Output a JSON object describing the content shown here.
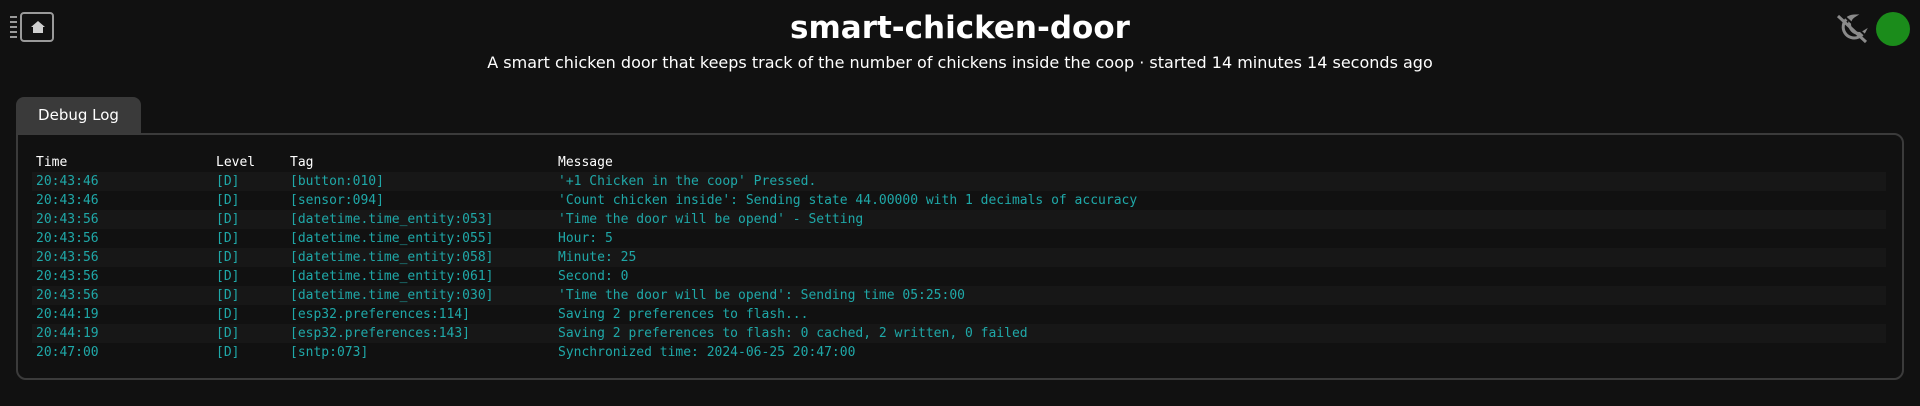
{
  "header": {
    "title": "smart-chicken-door",
    "subtitle": "A smart chicken door that keeps track of the number of chickens inside the coop · started 14 minutes 14 seconds ago",
    "logo_icon": "chip-home-icon",
    "theme_icon": "dark-mode-toggle-icon",
    "status_color": "#1b8c1b"
  },
  "tabs": [
    {
      "label": "Debug Log"
    }
  ],
  "log": {
    "columns": {
      "time": "Time",
      "level": "Level",
      "tag": "Tag",
      "message": "Message"
    },
    "rows": [
      {
        "time": "20:43:46",
        "level": "[D]",
        "tag": "[button:010]",
        "message": "'+1 Chicken in the coop' Pressed."
      },
      {
        "time": "20:43:46",
        "level": "[D]",
        "tag": "[sensor:094]",
        "message": "'Count chicken inside': Sending state 44.00000 with 1 decimals of accuracy"
      },
      {
        "time": "20:43:56",
        "level": "[D]",
        "tag": "[datetime.time_entity:053]",
        "message": "'Time the door will be opend' - Setting"
      },
      {
        "time": "20:43:56",
        "level": "[D]",
        "tag": "[datetime.time_entity:055]",
        "message": "Hour: 5"
      },
      {
        "time": "20:43:56",
        "level": "[D]",
        "tag": "[datetime.time_entity:058]",
        "message": "Minute: 25"
      },
      {
        "time": "20:43:56",
        "level": "[D]",
        "tag": "[datetime.time_entity:061]",
        "message": "Second: 0"
      },
      {
        "time": "20:43:56",
        "level": "[D]",
        "tag": "[datetime.time_entity:030]",
        "message": "'Time the door will be opend': Sending time 05:25:00"
      },
      {
        "time": "20:44:19",
        "level": "[D]",
        "tag": "[esp32.preferences:114]",
        "message": "Saving 2 preferences to flash..."
      },
      {
        "time": "20:44:19",
        "level": "[D]",
        "tag": "[esp32.preferences:143]",
        "message": "Saving 2 preferences to flash: 0 cached, 2 written, 0 failed"
      },
      {
        "time": "20:47:00",
        "level": "[D]",
        "tag": "[sntp:073]",
        "message": "Synchronized time: 2024-06-25 20:47:00"
      }
    ],
    "text_color": "#1fa8a8"
  }
}
